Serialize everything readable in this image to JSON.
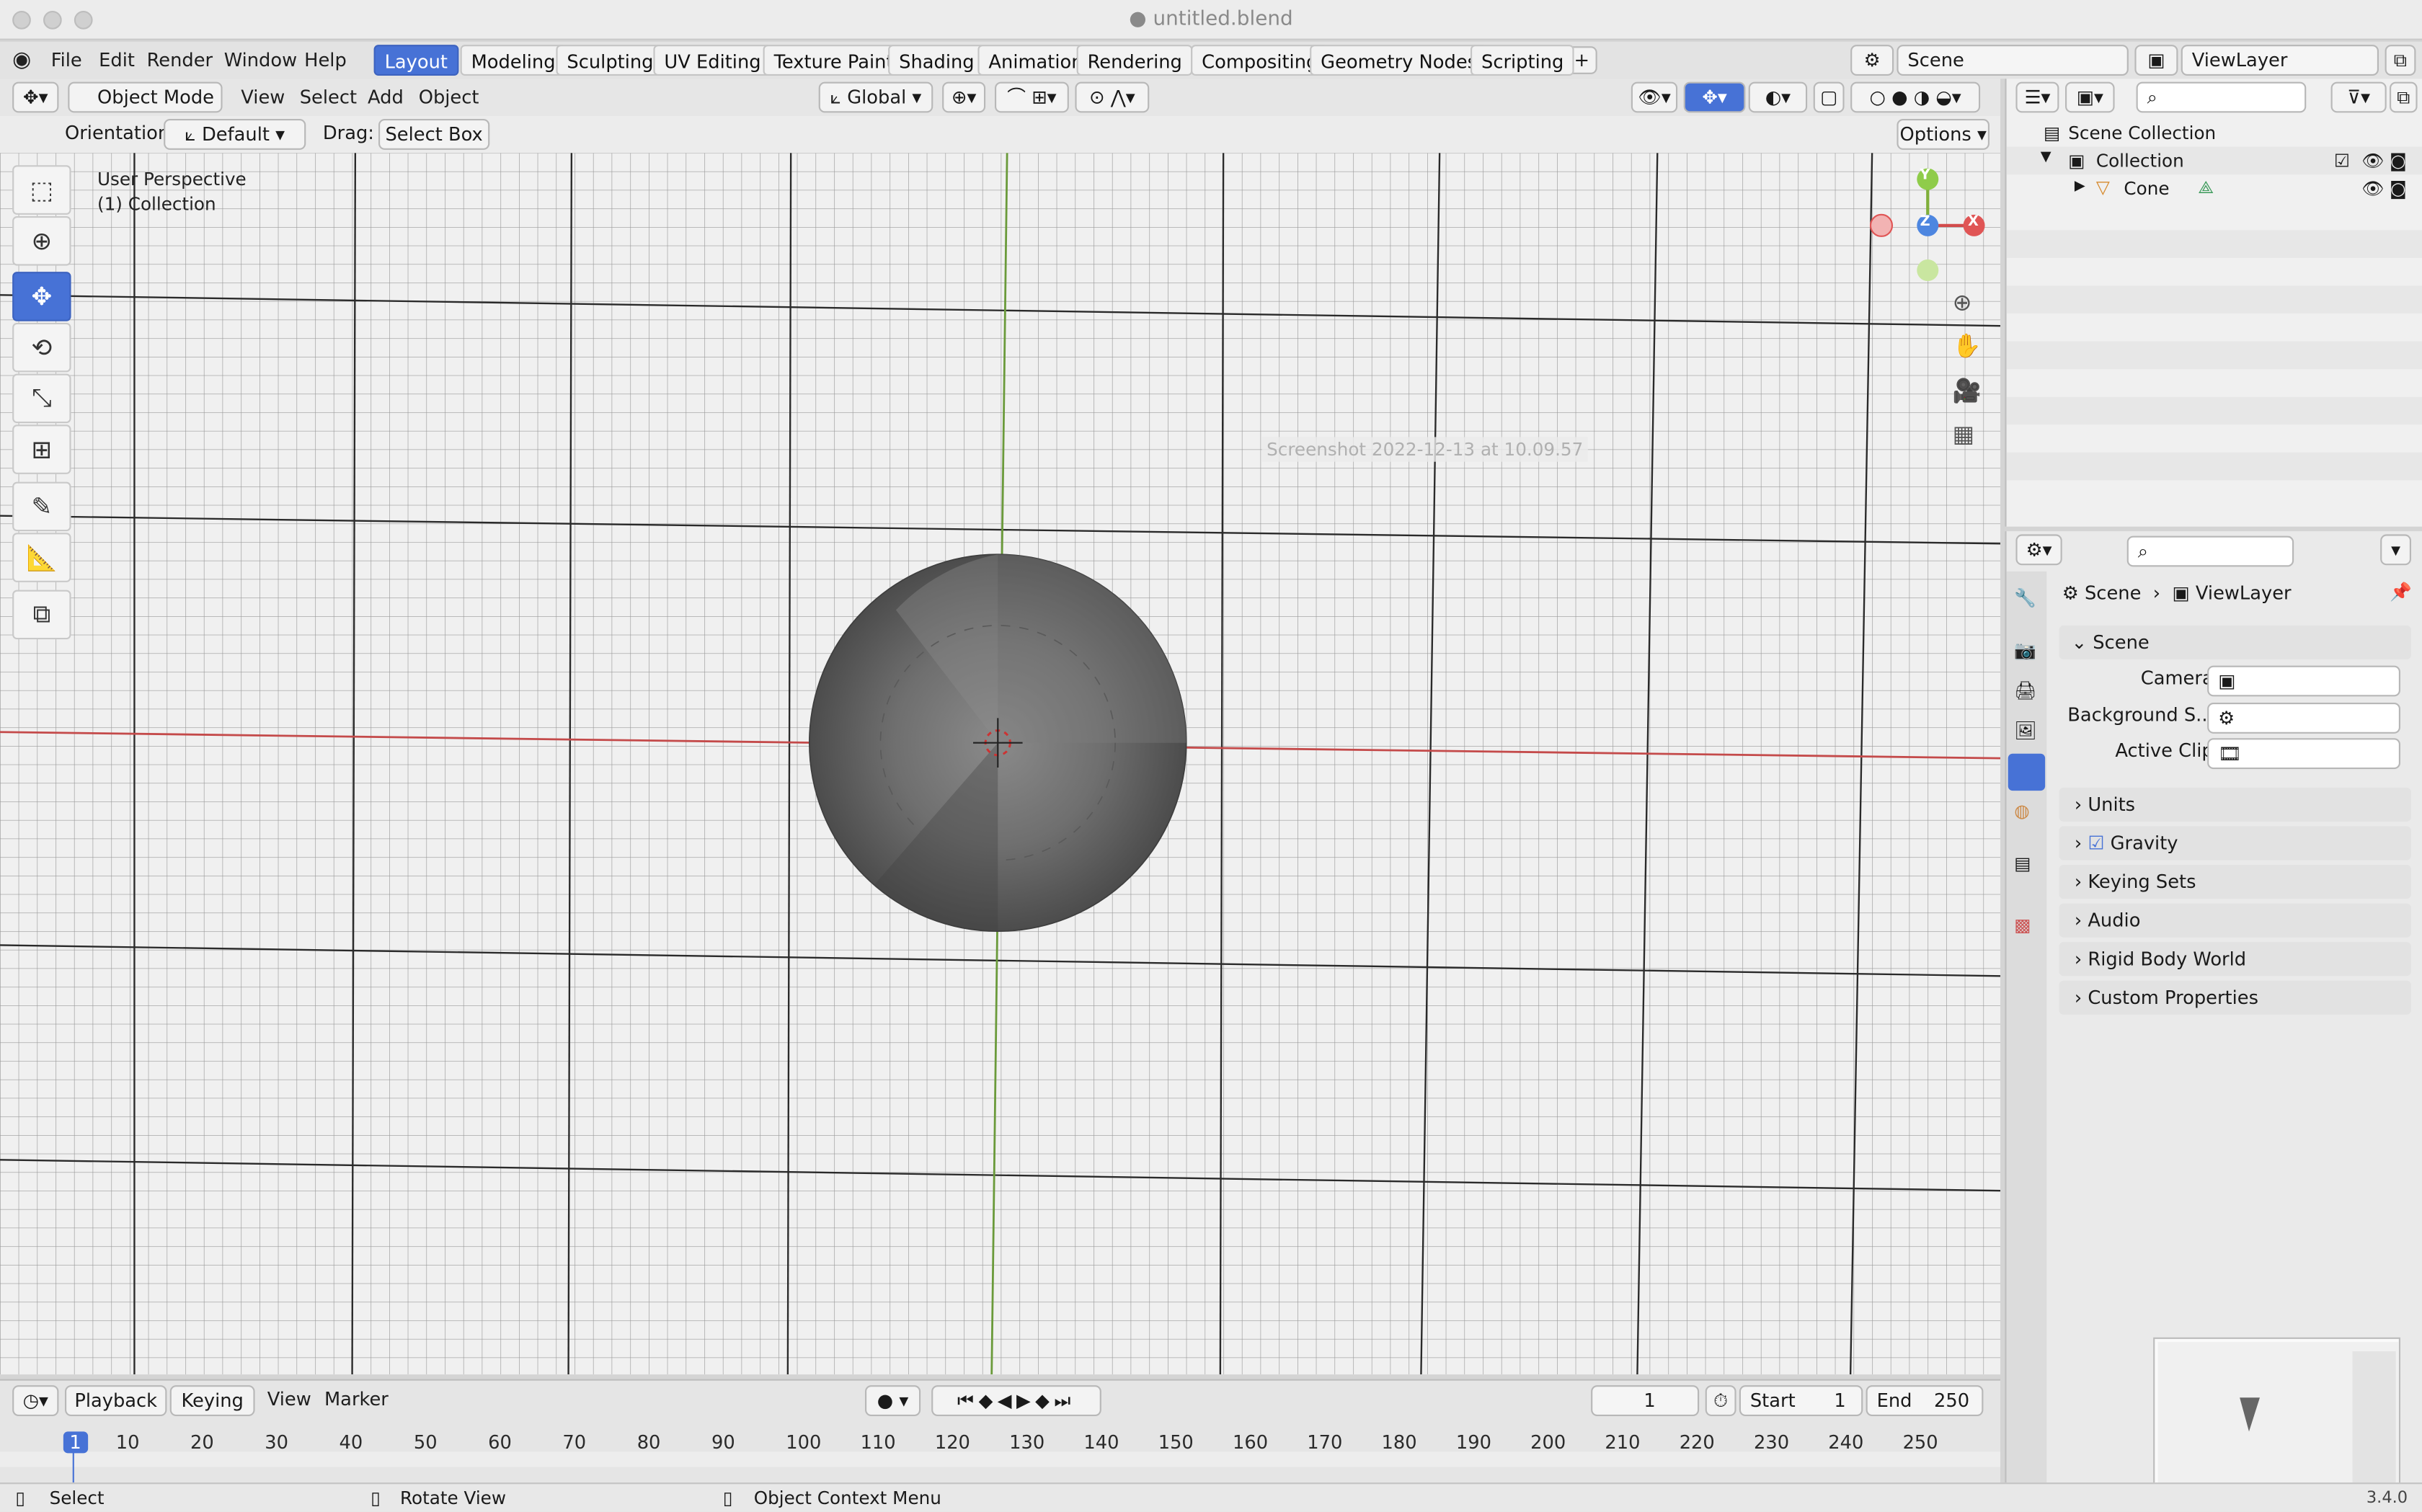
{
  "app": {
    "title": "untitled.blend",
    "version": "3.4.0"
  },
  "menu": [
    "File",
    "Edit",
    "Render",
    "Window",
    "Help"
  ],
  "workspaces": [
    "Layout",
    "Modeling",
    "Sculpting",
    "UV Editing",
    "Texture Paint",
    "Shading",
    "Animation",
    "Rendering",
    "Compositing",
    "Geometry Nodes",
    "Scripting"
  ],
  "scene_field": "Scene",
  "viewlayer_field": "ViewLayer",
  "header": {
    "mode": "Object Mode",
    "menus": [
      "View",
      "Select",
      "Add",
      "Object"
    ],
    "transform": "Global",
    "orientation_label": "Orientation:",
    "orientation_value": "Default",
    "drag_label": "Drag:",
    "drag_value": "Select Box",
    "options": "Options"
  },
  "viewport": {
    "line1": "User Perspective",
    "line2": "(1) Collection",
    "screenshot_label": "Screenshot 2022-12-13 at 10.09.57"
  },
  "gizmo": {
    "y": "Y",
    "z": "Z",
    "x": "X"
  },
  "outliner": {
    "root": "Scene Collection",
    "collection": "Collection",
    "object": "Cone"
  },
  "properties": {
    "breadcrumb_scene": "Scene",
    "breadcrumb_view": "ViewLayer",
    "section": "Scene",
    "rows": [
      {
        "label": "Camera"
      },
      {
        "label": "Background S..."
      },
      {
        "label": "Active Clip"
      }
    ],
    "panels": [
      "Units",
      "Gravity",
      "Keying Sets",
      "Audio",
      "Rigid Body World",
      "Custom Properties"
    ]
  },
  "timeline": {
    "menus": [
      "Playback",
      "Keying",
      "View",
      "Marker"
    ],
    "current_frame": "1",
    "start_label": "Start",
    "start": "1",
    "end_label": "End",
    "end": "250",
    "ticks": [
      "1",
      "10",
      "20",
      "30",
      "40",
      "50",
      "60",
      "70",
      "80",
      "90",
      "100",
      "110",
      "120",
      "130",
      "140",
      "150",
      "160",
      "170",
      "180",
      "190",
      "200",
      "210",
      "220",
      "230",
      "240",
      "250"
    ]
  },
  "status": {
    "select": "Select",
    "rotate": "Rotate View",
    "context": "Object Context Menu"
  }
}
